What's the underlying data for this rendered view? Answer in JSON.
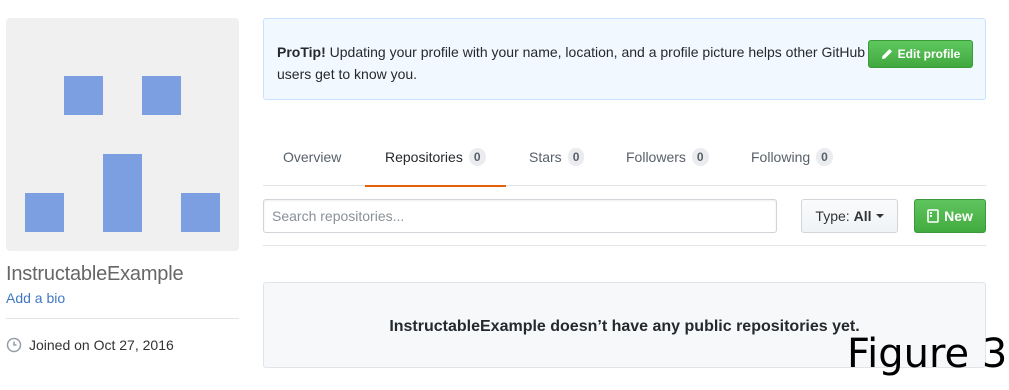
{
  "profile": {
    "username": "InstructableExample",
    "bio_link": "Add a bio",
    "joined": "Joined on Oct 27, 2016"
  },
  "protip": {
    "label": "ProTip!",
    "text": " Updating your profile with your name, location, and a profile picture helps other GitHub users get to know you.",
    "button_label": "Edit profile"
  },
  "tabs": [
    {
      "label": "Overview",
      "count": null
    },
    {
      "label": "Repositories",
      "count": "0"
    },
    {
      "label": "Stars",
      "count": "0"
    },
    {
      "label": "Followers",
      "count": "0"
    },
    {
      "label": "Following",
      "count": "0"
    }
  ],
  "selected_tab": "Repositories",
  "search": {
    "placeholder": "Search repositories...",
    "type_label": "Type:",
    "type_value": "All",
    "new_label": "New"
  },
  "blank_state": "InstructableExample doesn’t have any public repositories yet.",
  "figure_label": "Figure 3",
  "colors": {
    "accent_green": "#41a83e",
    "tab_underline": "#e36209",
    "link": "#4078c0",
    "avatar_block": "#7b9fe0"
  },
  "icons": [
    "clock-icon",
    "pencil-icon",
    "repo-icon",
    "caret-down-icon"
  ]
}
